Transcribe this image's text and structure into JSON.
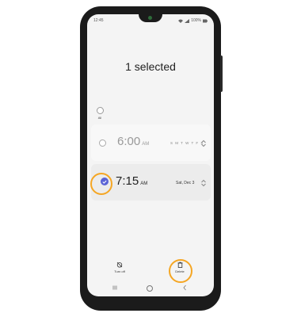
{
  "status_bar": {
    "time": "12:45",
    "battery": "100%"
  },
  "header": {
    "title": "1 selected"
  },
  "select_all": {
    "label": "All"
  },
  "alarms": [
    {
      "time": "6:00",
      "ampm": "AM",
      "repeat": "S M T W T F S",
      "selected": false
    },
    {
      "time": "7:15",
      "ampm": "AM",
      "repeat": "Sat, Dec 3",
      "selected": true
    }
  ],
  "actions": {
    "turn_off": "Turn off",
    "delete": "Delete"
  },
  "colors": {
    "accent": "#5a63d6",
    "highlight": "#f5a623"
  }
}
